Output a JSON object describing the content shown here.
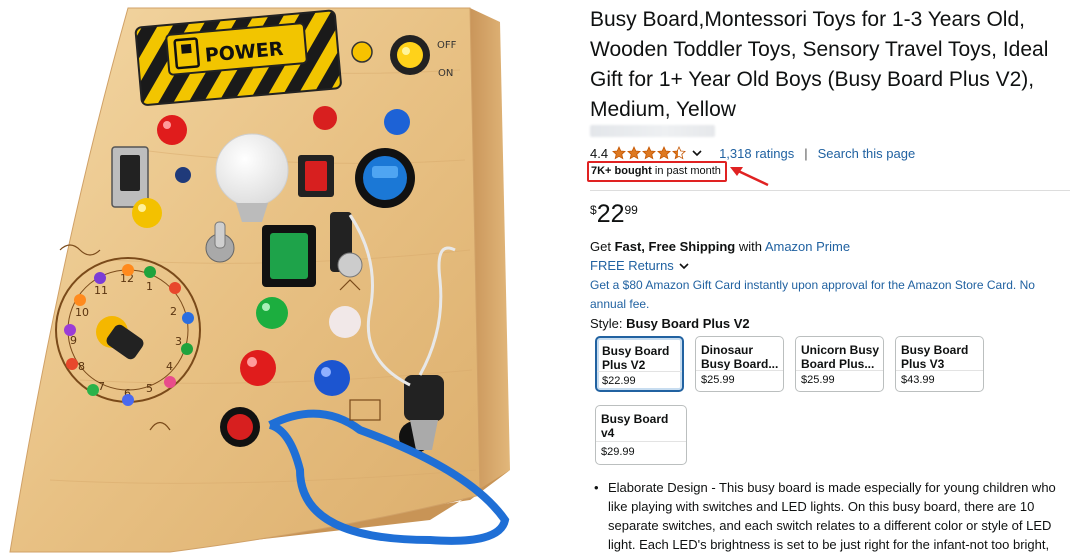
{
  "product": {
    "title": "Busy Board,Montessori Toys for 1-3 Years Old, Wooden Toddler Toys, Sensory Travel Toys, Ideal Gift for 1+ Year Old Boys (Busy Board Plus V2), Medium, Yellow",
    "image_labels": {
      "power": "POWER",
      "off": "OFF",
      "on": "ON"
    }
  },
  "rating": {
    "value": "4.4",
    "stars_fraction": 0.88,
    "count_link": "1,318 ratings",
    "separator": "|",
    "search_link": "Search this page"
  },
  "bought": {
    "bold": "7K+ bought",
    "rest": " in past month"
  },
  "price": {
    "currency": "$",
    "whole": "22",
    "fraction": "99"
  },
  "shipping": {
    "prefix": "Get ",
    "bold": "Fast, Free Shipping",
    "middle": " with ",
    "link": "Amazon Prime"
  },
  "returns": {
    "label": "FREE Returns"
  },
  "giftcard": {
    "text": "Get a $80 Amazon Gift Card instantly upon approval for the Amazon Store Card. No annual fee."
  },
  "style": {
    "label": "Style: ",
    "selected": "Busy Board Plus V2",
    "options": [
      {
        "name": "Busy Board Plus V2",
        "price": "$22.99"
      },
      {
        "name": "Dinosaur Busy Board...",
        "price": "$25.99"
      },
      {
        "name": "Unicorn Busy Board Plus...",
        "price": "$25.99"
      },
      {
        "name": "Busy Board Plus V3",
        "price": "$43.99"
      },
      {
        "name": "Busy Board v4",
        "price": "$29.99"
      }
    ]
  },
  "bullets": [
    "Elaborate Design - This busy board is made especially for young children who like playing with switches and LED lights. On this busy board, there are 10 separate switches, and each switch relates to a different color or style of LED light. Each LED's brightness is set to be just right for the infant-not too bright,"
  ],
  "colors": {
    "link": "#2162A1",
    "star": "#DE7921",
    "highlight": "#E02222",
    "wood": "#E9C48A"
  }
}
